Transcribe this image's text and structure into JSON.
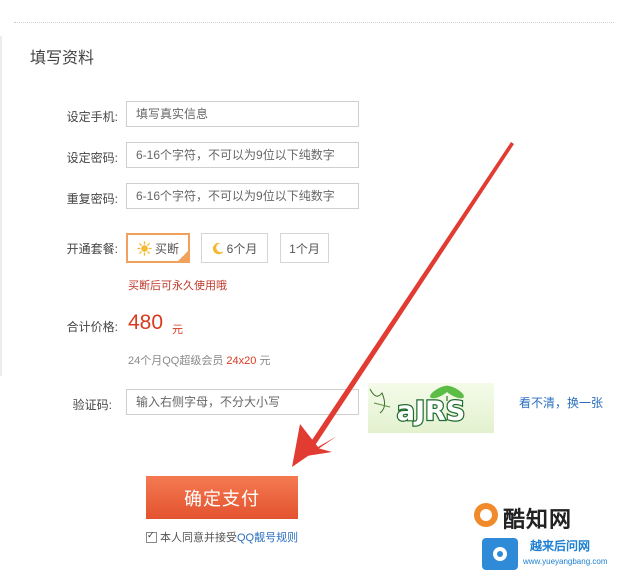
{
  "form": {
    "title": "填写资料",
    "phone": {
      "label": "设定手机:",
      "placeholder": "填写真实信息"
    },
    "password": {
      "label": "设定密码:",
      "placeholder": "6-16个字符，不可以为9位以下纯数字"
    },
    "password_repeat": {
      "label": "重复密码:",
      "placeholder": "6-16个字符，不可以为9位以下纯数字"
    },
    "plan": {
      "label": "开通套餐:",
      "options": [
        "买断",
        "6个月",
        "1个月"
      ],
      "selected": "买断",
      "note": "买断后可永久使用哦"
    },
    "total": {
      "label": "合计价格:",
      "amount": "480",
      "unit": "元",
      "detail_prefix": "24个月QQ超级会员",
      "detail_calc": "24x20",
      "detail_unit": "元"
    },
    "captcha": {
      "label": "验证码:",
      "placeholder": "输入右侧字母，不分大小写",
      "image_text": "aJRS",
      "refresh": "看不清，换一张"
    },
    "confirm": "确定支付",
    "agree": {
      "text": "本人同意并接受",
      "link": "QQ靓号规则",
      "checked": true
    }
  },
  "watermark": {
    "name": "酷知网",
    "sub": "越来后问网",
    "url": "www.yueyangbang.com"
  },
  "colors": {
    "accent": "#e3532f",
    "price": "#d93a1f",
    "link": "#2b6fbf",
    "selected_border": "#f2a15c"
  }
}
